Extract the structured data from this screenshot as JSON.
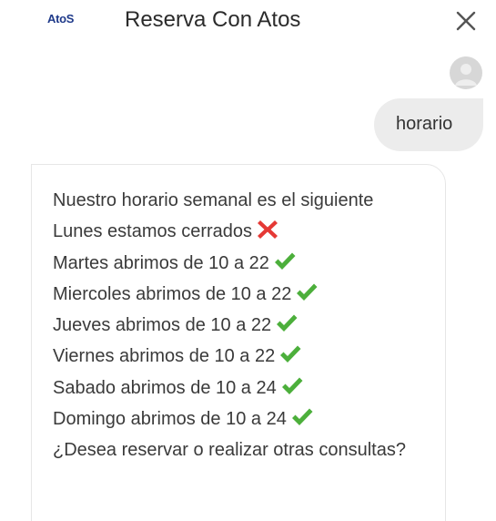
{
  "header": {
    "logo_text": "AtoS",
    "title": "Reserva Con Atos",
    "close_icon": "close-icon"
  },
  "conversation": {
    "user_message": "horario",
    "bot_lines": [
      {
        "text": "Nuestro horario semanal es el siguiente",
        "icon": ""
      },
      {
        "text": "Lunes estamos cerrados",
        "icon": "cross-mark-icon"
      },
      {
        "text": "Martes abrimos de 10 a 22",
        "icon": "check-mark-icon"
      },
      {
        "text": "Miercoles abrimos de 10 a 22",
        "icon": "check-mark-icon"
      },
      {
        "text": "Jueves abrimos de 10 a 22",
        "icon": "check-mark-icon"
      },
      {
        "text": "Viernes abrimos de 10 a 22",
        "icon": "check-mark-icon"
      },
      {
        "text": "Sabado abrimos de 10 a 24",
        "icon": "check-mark-icon"
      },
      {
        "text": "Domingo abrimos de 10 a 24",
        "icon": "check-mark-icon"
      },
      {
        "text": "¿Desea reservar o realizar otras consultas?",
        "icon": ""
      }
    ]
  },
  "colors": {
    "check": "#4caf3b",
    "cross": "#e53935",
    "logo": "#1f3a8a",
    "user_bubble": "#ececec"
  }
}
